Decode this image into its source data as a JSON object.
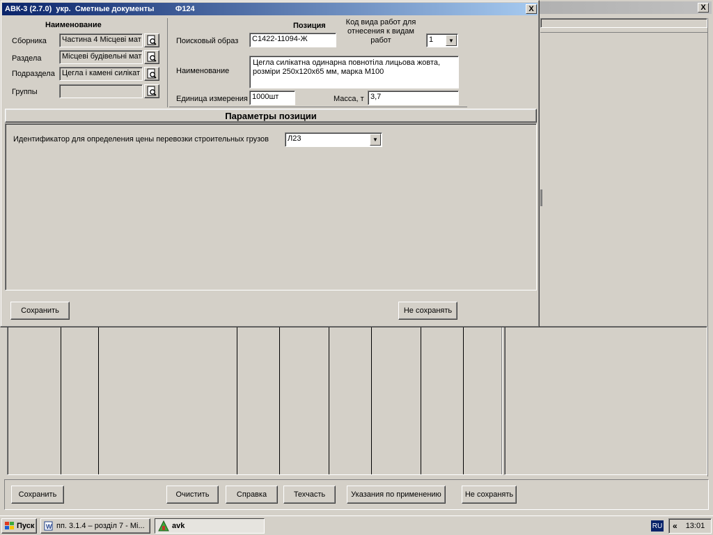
{
  "bg_window": {
    "close_label": "X"
  },
  "dialog": {
    "title": "АВК-3 (2.7.0)  укр.  Сметные документы          Ф124",
    "close_label": "X",
    "naming": {
      "heading": "Наименование",
      "collection_label": "Сборника",
      "collection_value": "Частина 4 Місцеві мат",
      "section_label": "Раздела",
      "section_value": "Місцеві будівельні мат",
      "subsection_label": "Подраздела",
      "subsection_value": "Цегла і камені силікат",
      "group_label": "Группы",
      "group_value": ""
    },
    "position": {
      "heading": "Позиция",
      "work_code_label": "Код вида работ для отнесения к видам работ",
      "work_code_value": "1",
      "search_label": "Поисковый образ",
      "search_value": "С1422-11094-Ж",
      "name_label": "Наименование",
      "name_value": "Цегла силікатна одинарна повнотіла лицьова жовта, розміри 250х120х65 мм, марка М100",
      "unit_label": "Единица измерения",
      "unit_value": "1000шт",
      "mass_label": "Масса, т",
      "mass_value": "3,7"
    },
    "params": {
      "heading": "Параметры позиции",
      "transport_label": "Идентификатор для определения цены перевозки строительных грузов",
      "transport_value": "Л23"
    },
    "save_label": "Сохранить",
    "nosave_label": "Не сохранять"
  },
  "bottom_toolbar": {
    "save": "Сохранить",
    "clear": "Очистить",
    "help": "Справка",
    "techpart": "Техчасть",
    "instructions": "Указания по применению",
    "nosave": "Не сохранять"
  },
  "taskbar": {
    "start_label": "Пуск",
    "task_word": "пп. 3.1.4 – розділ 7 - Мі...",
    "task_avk": "avk",
    "lang": "RU",
    "chevron": "«",
    "clock": "13:01"
  },
  "colors": {
    "title_gradient_start": "#0a246a",
    "title_gradient_end": "#a6caf0",
    "inactive_title": "#808080",
    "desktop_face": "#d4d0c8"
  }
}
